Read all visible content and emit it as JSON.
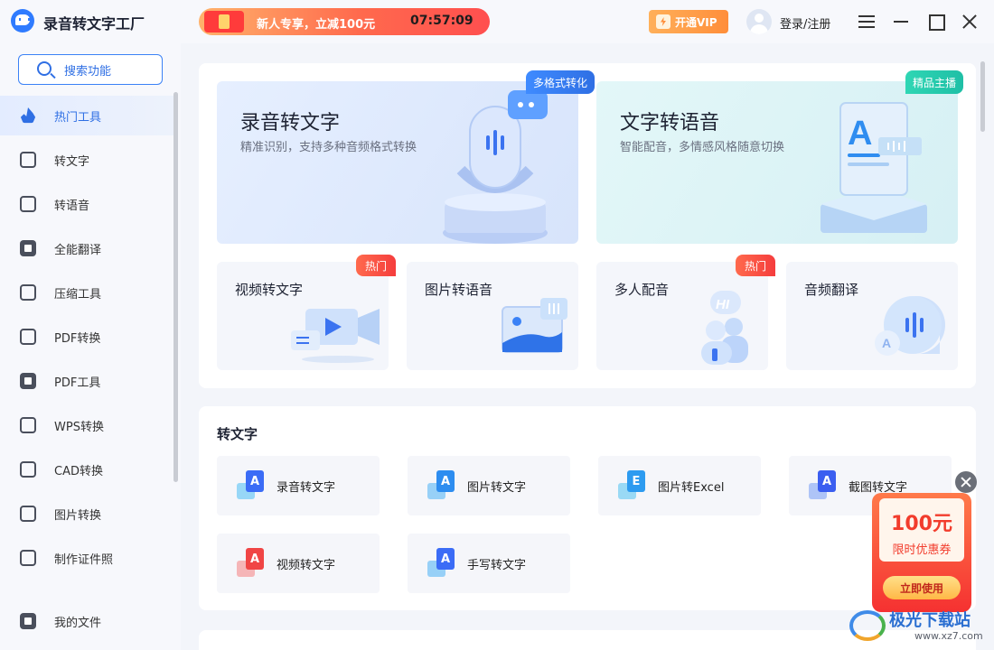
{
  "app": {
    "title": "录音转文字工厂"
  },
  "promo": {
    "text": "新人专享，立减100元",
    "timer": "07:57:09"
  },
  "header": {
    "vip_label": "开通VIP",
    "login_label": "登录/注册"
  },
  "sidebar": {
    "search_label": "搜索功能",
    "items": [
      {
        "label": "热门工具",
        "icon": "fire-icon",
        "active": true
      },
      {
        "label": "转文字",
        "icon": "text-convert-icon"
      },
      {
        "label": "转语音",
        "icon": "voice-icon"
      },
      {
        "label": "全能翻译",
        "icon": "translate-icon"
      },
      {
        "label": "压缩工具",
        "icon": "compress-icon"
      },
      {
        "label": "PDF转换",
        "icon": "pdf-convert-icon"
      },
      {
        "label": "PDF工具",
        "icon": "toolbox-icon"
      },
      {
        "label": "WPS转换",
        "icon": "wps-icon"
      },
      {
        "label": "CAD转换",
        "icon": "cad-icon"
      },
      {
        "label": "图片转换",
        "icon": "image-icon"
      },
      {
        "label": "制作证件照",
        "icon": "id-photo-icon"
      }
    ],
    "my_files_label": "我的文件"
  },
  "hot": {
    "cards": [
      {
        "title": "录音转文字",
        "desc": "精准识别，支持多种音频格式转换",
        "tag": "多格式转化"
      },
      {
        "title": "文字转语音",
        "desc": "智能配音，多情感风格随意切换",
        "tag": "精品主播"
      }
    ],
    "small_cards": [
      {
        "title": "视频转文字",
        "hot": "热门"
      },
      {
        "title": "图片转语音",
        "hot": ""
      },
      {
        "title": "多人配音",
        "hot": "热门"
      },
      {
        "title": "音频翻译",
        "hot": ""
      }
    ]
  },
  "to_text": {
    "title": "转文字",
    "items": [
      {
        "label": "录音转文字",
        "letter": "A",
        "color": "#3b6cf6"
      },
      {
        "label": "图片转文字",
        "letter": "A",
        "color": "#2d8df0"
      },
      {
        "label": "图片转Excel",
        "letter": "E",
        "color": "#2d9bf0"
      },
      {
        "label": "截图转文字",
        "letter": "A",
        "color": "#3b5ef0"
      },
      {
        "label": "视频转文字",
        "letter": "A",
        "color": "#f04545"
      },
      {
        "label": "手写转文字",
        "letter": "A",
        "color": "#3b6cf6"
      }
    ]
  },
  "coupon": {
    "amount": "100元",
    "label": "限时优惠券",
    "button": "立即使用"
  },
  "watermark": {
    "text": "极光下载站",
    "url": "www.xz7.com"
  }
}
